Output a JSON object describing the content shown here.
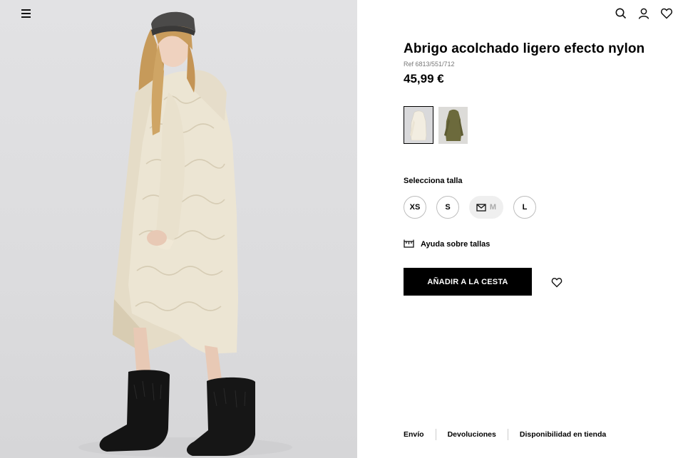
{
  "product": {
    "title": "Abrigo acolchado ligero efecto nylon",
    "ref": "Ref 6813/551/712",
    "price": "45,99 €"
  },
  "colors": [
    {
      "name": "crudo",
      "selected": true,
      "swatch": "#efe9dc"
    },
    {
      "name": "khaki",
      "selected": false,
      "swatch": "#6b6a3a"
    }
  ],
  "sizes": {
    "label": "Selecciona talla",
    "options": [
      {
        "label": "XS",
        "available": true
      },
      {
        "label": "S",
        "available": true
      },
      {
        "label": "M",
        "available": false
      },
      {
        "label": "L",
        "available": true
      }
    ]
  },
  "help": {
    "label": "Ayuda sobre tallas"
  },
  "cta": {
    "add_label": "AÑADIR A LA CESTA"
  },
  "footer": {
    "links": [
      "Envío",
      "Devoluciones",
      "Disponibilidad en tienda"
    ]
  },
  "icons": [
    "menu-icon",
    "search-icon",
    "user-icon",
    "heart-icon",
    "mail-icon",
    "ruler-icon"
  ],
  "theme": {
    "accent": "#000000",
    "background": "#ffffff",
    "photo_bg": "#dedee0"
  }
}
